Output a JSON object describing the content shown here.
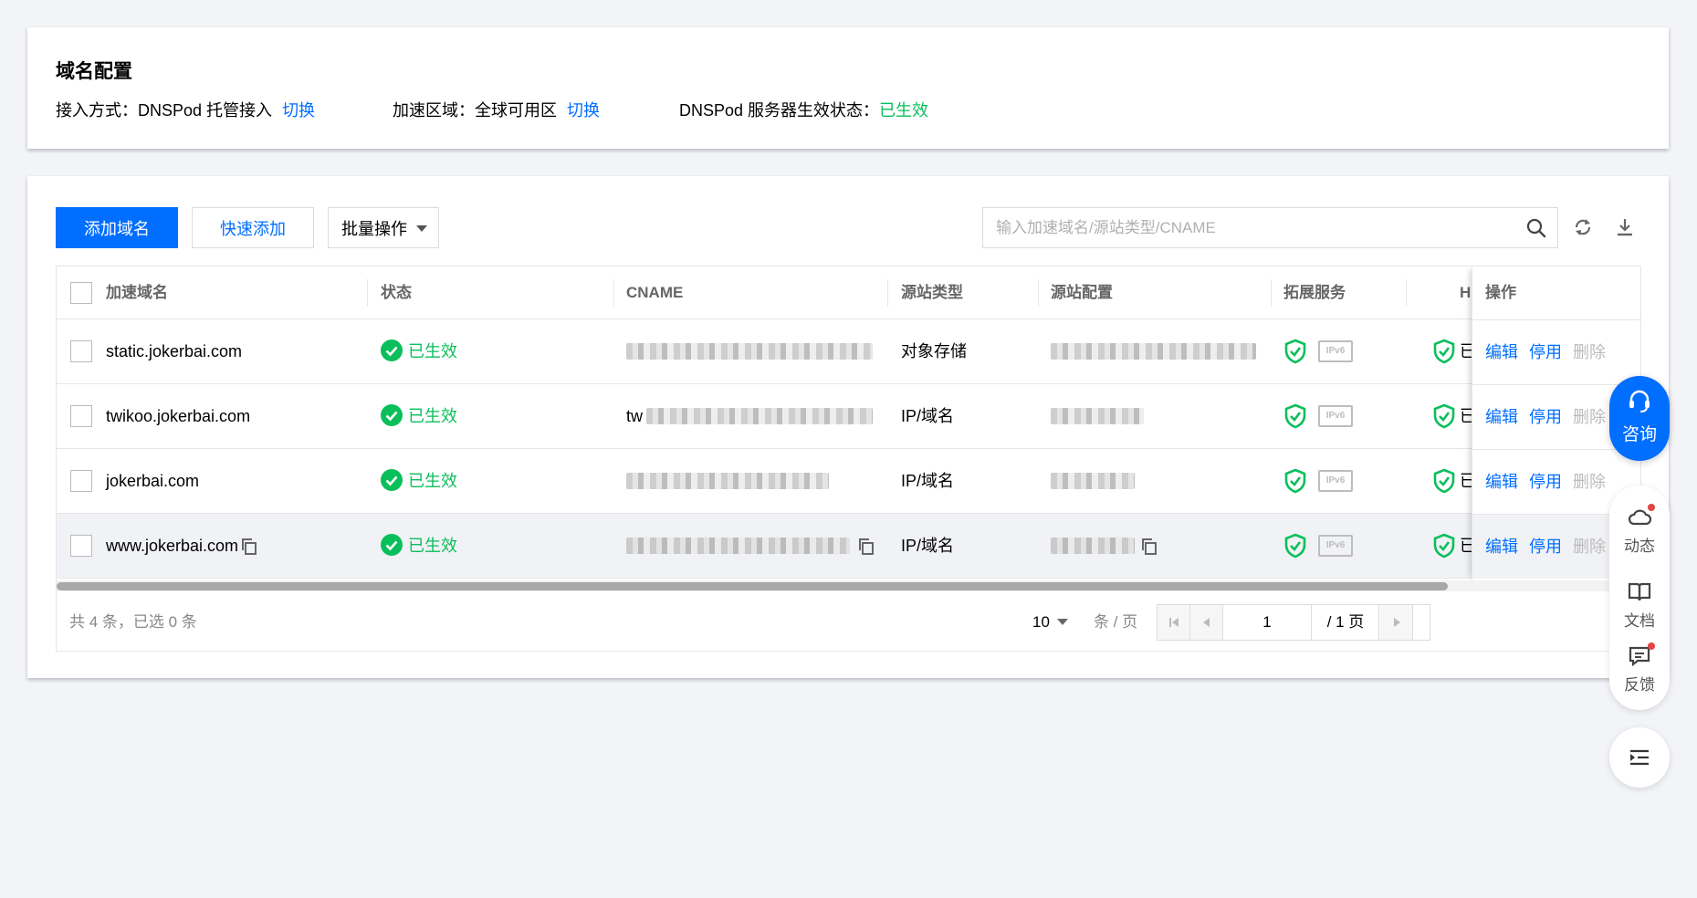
{
  "config": {
    "title": "域名配置",
    "access_label": "接入方式：DNSPod 托管接入",
    "access_switch": "切换",
    "region_label": "加速区域：全球可用区",
    "region_switch": "切换",
    "dnspod_label": "DNSPod 服务器生效状态：",
    "dnspod_status": "已生效"
  },
  "toolbar": {
    "add_domain": "添加域名",
    "quick_add": "快速添加",
    "batch": "批量操作",
    "search_placeholder": "输入加速域名/源站类型/CNAME"
  },
  "table": {
    "headers": {
      "domain": "加速域名",
      "status": "状态",
      "cname": "CNAME",
      "origin_type": "源站类型",
      "origin_config": "源站配置",
      "ext": "拓展服务",
      "h": "H",
      "ops": "操作"
    },
    "rows": [
      {
        "domain": "static.jokerbai.com",
        "status": "已生效",
        "origin_type": "对象存储",
        "cname_visible": "",
        "origin_visible": "",
        "ipv6": "IPv6",
        "h": "已"
      },
      {
        "domain": "twikoo.jokerbai.com",
        "status": "已生效",
        "origin_type": "IP/域名",
        "cname_visible": "tw",
        "origin_visible": "",
        "ipv6": "IPv6",
        "h": "已"
      },
      {
        "domain": "jokerbai.com",
        "status": "已生效",
        "origin_type": "IP/域名",
        "cname_visible": "",
        "origin_visible": "",
        "ipv6": "IPv6",
        "h": "已"
      },
      {
        "domain": "www.jokerbai.com",
        "status": "已生效",
        "origin_type": "IP/域名",
        "cname_visible": "",
        "origin_visible": "",
        "ipv6": "IPv6",
        "h": "已"
      }
    ],
    "ops": {
      "edit": "编辑",
      "disable": "停用",
      "delete": "删除"
    }
  },
  "footer": {
    "total": "共 4 条，已选 0 条",
    "page_size": "10",
    "per_page": "条 / 页",
    "page": "1",
    "page_total": "/ 1 页"
  },
  "float": {
    "consult": "咨询",
    "news": "动态",
    "docs": "文档",
    "feedback": "反馈"
  },
  "colors": {
    "primary": "#006eff",
    "success": "#0abf5b",
    "disabled": "#bbbbbb"
  }
}
